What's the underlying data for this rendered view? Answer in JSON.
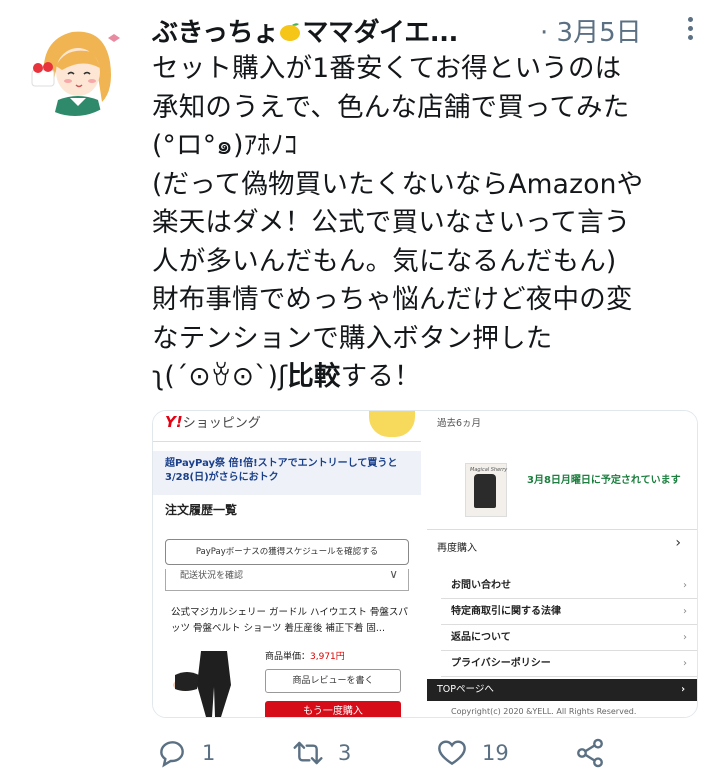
{
  "tweet": {
    "author_name": "ぶきっちょ",
    "author_name_tail": "ママダイエ...",
    "date": "· 3月5日",
    "text_lines": [
      "セット購入が1番安くてお得というのは",
      "承知のうえで、色んな店舗で買ってみた",
      "(°ロ°๑)ｱﾎﾉｺ",
      "(だって偽物買いたくないならAmazonや",
      "楽天はダメ！公式で買いなさいって言う",
      "人が多いんだもん。気になるんだもん)",
      "財布事情でめっちゃ悩んだけど夜中の変",
      "なテンションで購入ボタン押した"
    ],
    "last_line_prefix": "ʅ(´⊙ꈊ⊙`)ʃ",
    "last_line_bold": "比較",
    "last_line_suffix": "する！"
  },
  "media": {
    "panel1": {
      "logo": "Y!",
      "logo_text": "ショッピング",
      "promo": "超PayPay祭 倍!倍!ストアでエントリーして買うと3/28(日)がさらにおトク",
      "order_history_title": "注文履歴一覧",
      "paypay_button": "PayPayボーナスの獲得スケジュールを確認する"
    },
    "panel2": {
      "period": "過去6ヵ月",
      "delivery": "3月8日月曜日に予定されています",
      "rebuy": "再度購入",
      "chevron": "›"
    },
    "panel3": {
      "status_select": "配送状況を確認",
      "status_arrow": "∨",
      "product_name": "公式マジカルシェリー ガードル ハイウエスト 骨盤スパッツ 骨盤ベルト ショーツ 着圧産後 補正下着 固...",
      "price_label": "商品単価：",
      "price_value": "3,971円",
      "review_button": "商品レビューを書く",
      "rebuy_button": "もう一度購入"
    },
    "panel4": {
      "links": [
        "お問い合わせ",
        "特定商取引に関する法律",
        "返品について",
        "プライバシーポリシー"
      ],
      "link_arrow": "›",
      "top_link": "TOPページへ",
      "top_arrow": "›",
      "copyright": "Copyright(c) 2020 &YELL. All Rights Reserved."
    }
  },
  "actions": {
    "reply_count": "1",
    "retweet_count": "3",
    "like_count": "19"
  },
  "colors": {
    "icon_gray": "#5b7083",
    "yahoo_red": "#e60012",
    "delivery_green": "#1b7e3e"
  }
}
